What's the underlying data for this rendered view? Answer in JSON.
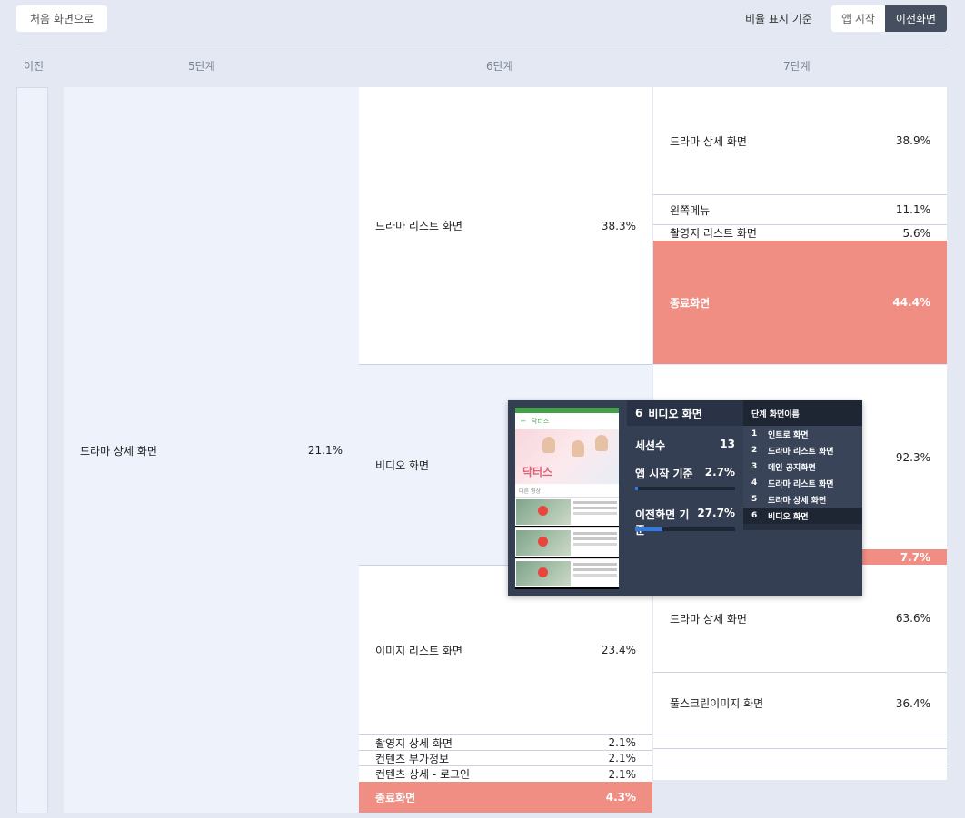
{
  "toolbar": {
    "home_button": "처음 화면으로",
    "ratio_label": "비율 표시 기준",
    "ratio_options": [
      "앱 시작",
      "이전화면"
    ],
    "ratio_selected": "이전화면"
  },
  "columns": {
    "prev": "이전",
    "step5": "5단계",
    "step6": "6단계",
    "step7": "7단계"
  },
  "step5": {
    "name": "드라마 상세 화면",
    "pct": "21.1%"
  },
  "step6": [
    {
      "name": "드라마 리스트 화면",
      "pct": "38.3%"
    },
    {
      "name": "비디오 화면",
      "pct": ""
    },
    {
      "name": "이미지 리스트 화면",
      "pct": "23.4%"
    },
    {
      "name": "촬영지 상세 화면",
      "pct": "2.1%"
    },
    {
      "name": "컨텐츠 부가정보",
      "pct": "2.1%"
    },
    {
      "name": "컨텐츠 상세 - 로그인",
      "pct": "2.1%"
    },
    {
      "name": "종료화면",
      "pct": "4.3%"
    }
  ],
  "step7": [
    {
      "name": "드라마 상세 화면",
      "pct": "38.9%"
    },
    {
      "name": "왼쪽메뉴",
      "pct": "11.1%"
    },
    {
      "name": "촬영지 리스트 화면",
      "pct": "5.6%"
    },
    {
      "name": "종료화면",
      "pct": "44.4%"
    },
    {
      "name": "",
      "pct": "92.3%"
    },
    {
      "name": "",
      "pct": "7.7%"
    },
    {
      "name": "드라마 상세 화면",
      "pct": "63.6%"
    },
    {
      "name": "풀스크린이미지 화면",
      "pct": "36.4%"
    }
  ],
  "tooltip": {
    "step": "6",
    "screen": "비디오 화면",
    "sessions_label": "세션수",
    "sessions": "13",
    "app_start_label": "앱 시작 기준",
    "app_start_pct": "2.7%",
    "app_start_fraction": 0.027,
    "prev_label": "이전화면 기준",
    "prev_pct": "27.7%",
    "prev_fraction": 0.277,
    "path_header": "단계 화면이름",
    "path": [
      {
        "n": "1",
        "name": "인트로 화면"
      },
      {
        "n": "2",
        "name": "드라마 리스트 화면"
      },
      {
        "n": "3",
        "name": "메인 공지화면"
      },
      {
        "n": "4",
        "name": "드라마 리스트 화면"
      },
      {
        "n": "5",
        "name": "드라마 상세 화면"
      },
      {
        "n": "6",
        "name": "비디오 화면"
      }
    ],
    "thumb": {
      "app_title": "닥터스",
      "poster_title": "닥터스",
      "section_label": "다른 영상"
    }
  },
  "colors": {
    "exit": "#f18e84",
    "accent_bar": "#2f7be5",
    "tooltip_bg": "#353f54",
    "toggle_active": "#454f60"
  }
}
